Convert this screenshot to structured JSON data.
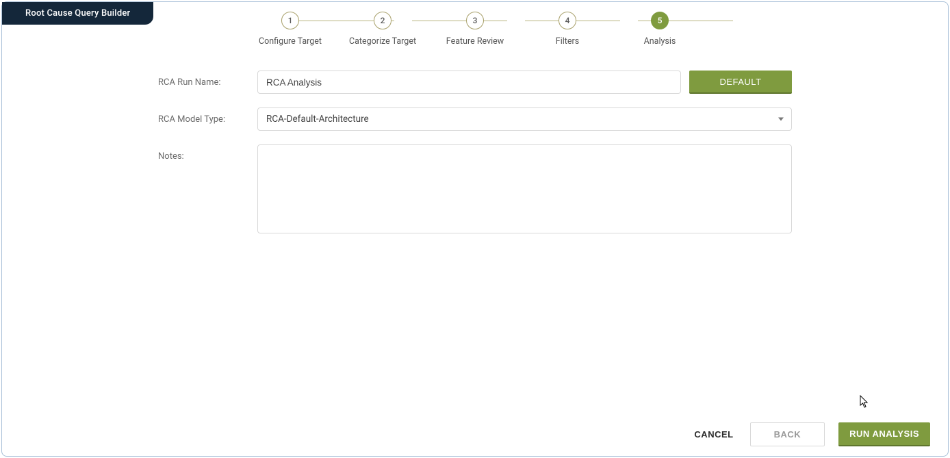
{
  "title": "Root Cause Query Builder",
  "stepper": {
    "steps": [
      {
        "num": "1",
        "label": "Configure Target"
      },
      {
        "num": "2",
        "label": "Categorize Target"
      },
      {
        "num": "3",
        "label": "Feature Review"
      },
      {
        "num": "4",
        "label": "Filters"
      },
      {
        "num": "5",
        "label": "Analysis"
      }
    ],
    "active_index": 4
  },
  "form": {
    "run_name": {
      "label": "RCA Run Name:",
      "value": "RCA Analysis"
    },
    "default_button": "DEFAULT",
    "model_type": {
      "label": "RCA Model Type:",
      "selected": "RCA-Default-Architecture"
    },
    "notes": {
      "label": "Notes:",
      "value": ""
    }
  },
  "footer": {
    "cancel": "CANCEL",
    "back": "BACK",
    "run": "RUN ANALYSIS"
  },
  "colors": {
    "accent": "#7f9b3f",
    "title_bg": "#14273a",
    "border": "#d8d8d8",
    "panel_border": "#a8c0d8"
  }
}
